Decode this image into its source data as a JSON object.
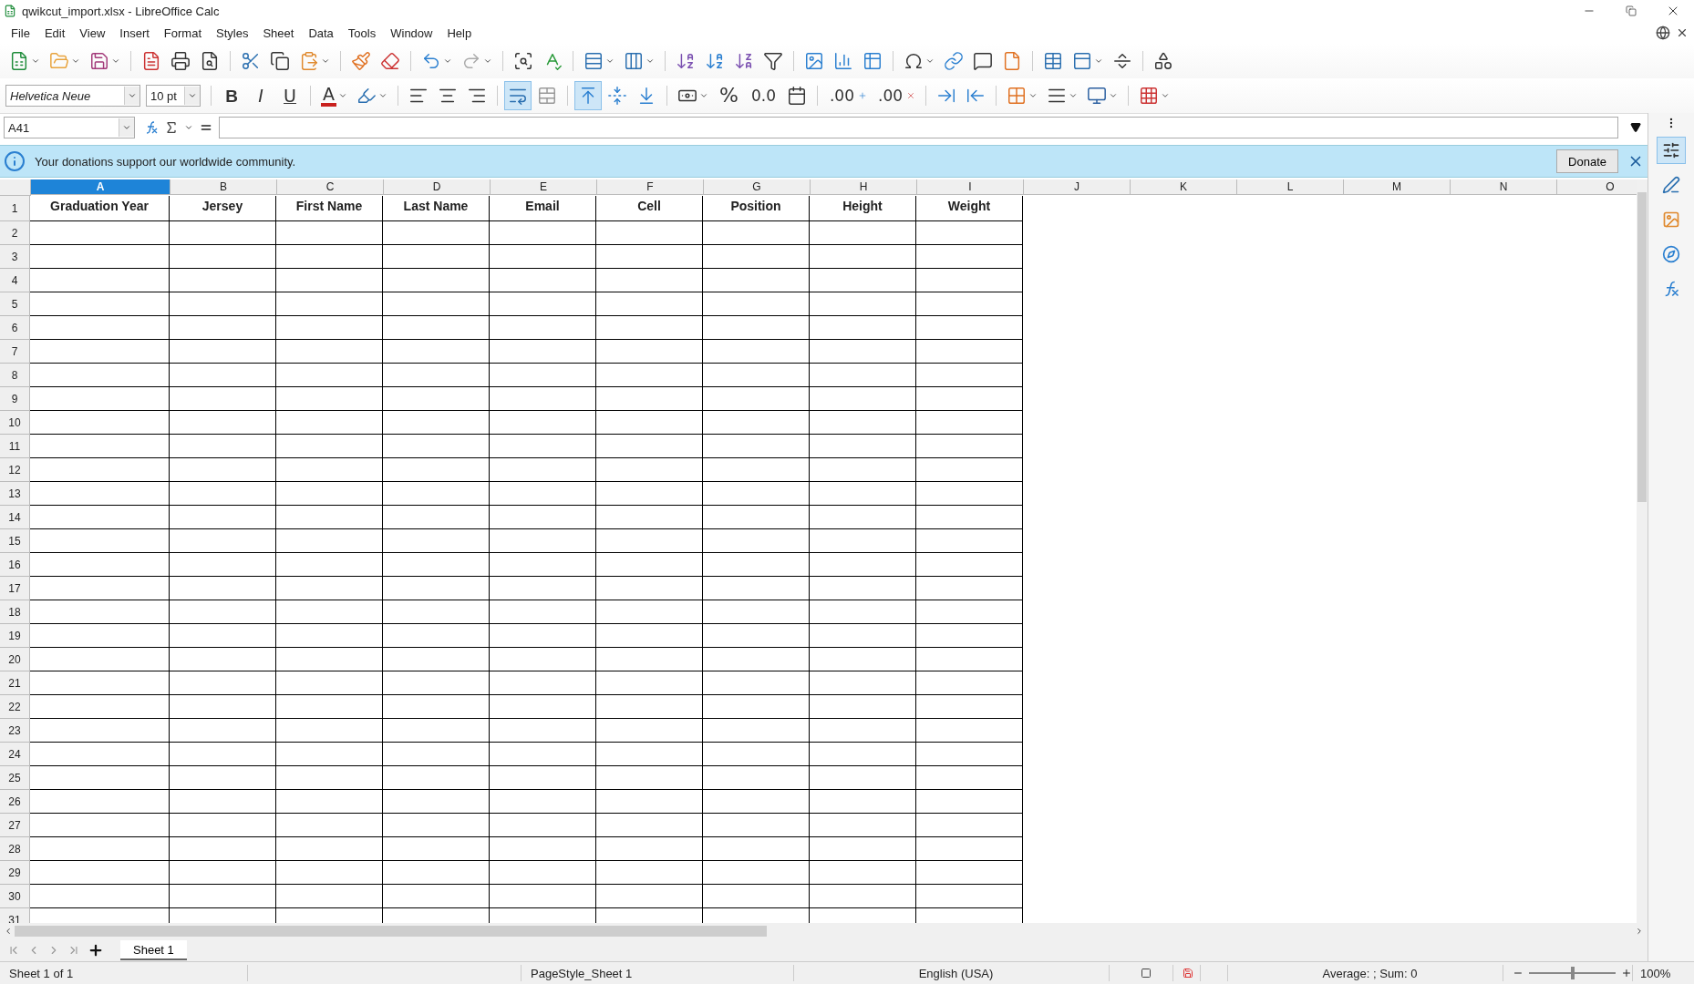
{
  "window": {
    "title": "qwikcut_import.xlsx - LibreOffice Calc"
  },
  "menu": [
    "File",
    "Edit",
    "View",
    "Insert",
    "Format",
    "Styles",
    "Sheet",
    "Data",
    "Tools",
    "Window",
    "Help"
  ],
  "toolbar_standard": [
    {
      "kind": "new",
      "dropdown": true
    },
    {
      "kind": "open",
      "dropdown": true
    },
    {
      "kind": "save",
      "dropdown": true
    },
    {
      "kind": "sep"
    },
    {
      "kind": "pdf",
      "dropdown": false
    },
    {
      "kind": "print",
      "dropdown": false
    },
    {
      "kind": "preview",
      "dropdown": false
    },
    {
      "kind": "sep"
    },
    {
      "kind": "cut",
      "dropdown": false
    },
    {
      "kind": "copy",
      "dropdown": false
    },
    {
      "kind": "paste",
      "dropdown": true
    },
    {
      "kind": "sep"
    },
    {
      "kind": "clone",
      "dropdown": false
    },
    {
      "kind": "clear",
      "dropdown": false
    },
    {
      "kind": "sep"
    },
    {
      "kind": "undo",
      "dropdown": true
    },
    {
      "kind": "redo",
      "dropdown": true
    },
    {
      "kind": "sep"
    },
    {
      "kind": "find",
      "dropdown": false
    },
    {
      "kind": "spell",
      "dropdown": false
    },
    {
      "kind": "sep"
    },
    {
      "kind": "row",
      "dropdown": true
    },
    {
      "kind": "column",
      "dropdown": true
    },
    {
      "kind": "sep"
    },
    {
      "kind": "sort",
      "dropdown": false
    },
    {
      "kind": "sort_asc",
      "dropdown": false
    },
    {
      "kind": "sort_desc",
      "dropdown": false
    },
    {
      "kind": "filter",
      "dropdown": false
    },
    {
      "kind": "sep"
    },
    {
      "kind": "image",
      "dropdown": false
    },
    {
      "kind": "chart",
      "dropdown": false
    },
    {
      "kind": "pivot",
      "dropdown": false
    },
    {
      "kind": "sep"
    },
    {
      "kind": "special",
      "dropdown": true
    },
    {
      "kind": "link",
      "dropdown": false
    },
    {
      "kind": "comment",
      "dropdown": false
    },
    {
      "kind": "header",
      "dropdown": false
    },
    {
      "kind": "sep"
    },
    {
      "kind": "print_range",
      "dropdown": false
    },
    {
      "kind": "freeze",
      "dropdown": true
    },
    {
      "kind": "split",
      "dropdown": false
    },
    {
      "kind": "sep"
    },
    {
      "kind": "shapes",
      "dropdown": false
    }
  ],
  "toolbar_format": {
    "font": "Helvetica Neue",
    "size": "10 pt",
    "buttons": [
      {
        "kind": "sep"
      },
      {
        "kind": "bold",
        "label": "B",
        "on": false,
        "dropdown": false
      },
      {
        "kind": "italic",
        "label": "I",
        "on": false,
        "dropdown": false
      },
      {
        "kind": "underline",
        "label": "U",
        "on": false,
        "dropdown": false
      },
      {
        "kind": "sep"
      },
      {
        "kind": "font_color",
        "label": "A",
        "on": false,
        "dropdown": true
      },
      {
        "kind": "highlight",
        "on": false,
        "dropdown": true
      },
      {
        "kind": "sep"
      },
      {
        "kind": "align_left",
        "on": false,
        "dropdown": false
      },
      {
        "kind": "align_center",
        "on": false,
        "dropdown": false
      },
      {
        "kind": "align_right",
        "on": false,
        "dropdown": false
      },
      {
        "kind": "sep"
      },
      {
        "kind": "wrap",
        "on": true,
        "dropdown": false
      },
      {
        "kind": "merge",
        "on": false,
        "dropdown": false
      },
      {
        "kind": "sep"
      },
      {
        "kind": "align_top",
        "on": true,
        "dropdown": false
      },
      {
        "kind": "align_middle",
        "on": false,
        "dropdown": false
      },
      {
        "kind": "align_bottom",
        "on": false,
        "dropdown": false
      },
      {
        "kind": "sep"
      },
      {
        "kind": "currency",
        "on": false,
        "dropdown": true
      },
      {
        "kind": "percent",
        "label": "%",
        "on": false,
        "dropdown": false
      },
      {
        "kind": "number",
        "label": "0.0",
        "on": false,
        "dropdown": false
      },
      {
        "kind": "date",
        "on": false,
        "dropdown": false
      },
      {
        "kind": "sep"
      },
      {
        "kind": "add_decimal",
        "label": ".00",
        "on": false,
        "dropdown": false
      },
      {
        "kind": "delete_decimal",
        "label": ".00",
        "on": false,
        "dropdown": false
      },
      {
        "kind": "sep"
      },
      {
        "kind": "indent",
        "on": false,
        "dropdown": false
      },
      {
        "kind": "outdent",
        "on": false,
        "dropdown": false
      },
      {
        "kind": "sep"
      },
      {
        "kind": "borders",
        "on": false,
        "dropdown": true
      },
      {
        "kind": "border_style",
        "on": false,
        "dropdown": true
      },
      {
        "kind": "border_color",
        "on": false,
        "dropdown": true
      },
      {
        "kind": "sep"
      },
      {
        "kind": "conditional",
        "on": false,
        "dropdown": true
      }
    ]
  },
  "formula_bar": {
    "cell": "A41"
  },
  "infobar": {
    "message": "Your donations support our worldwide community.",
    "button": "Donate"
  },
  "columns": [
    {
      "label": "A",
      "selected": true
    },
    {
      "label": "B",
      "selected": false
    },
    {
      "label": "C",
      "selected": false
    },
    {
      "label": "D",
      "selected": false
    },
    {
      "label": "E",
      "selected": false
    },
    {
      "label": "F",
      "selected": false
    },
    {
      "label": "G",
      "selected": false
    },
    {
      "label": "H",
      "selected": false
    },
    {
      "label": "I",
      "selected": false
    },
    {
      "label": "J",
      "selected": false
    },
    {
      "label": "K",
      "selected": false
    },
    {
      "label": "L",
      "selected": false
    },
    {
      "label": "M",
      "selected": false
    },
    {
      "label": "N",
      "selected": false
    },
    {
      "label": "O",
      "selected": false
    }
  ],
  "header_cells": [
    "Graduation Year",
    "Jersey",
    "First Name",
    "Last Name",
    "Email",
    "Cell",
    "Position",
    "Height",
    "Weight"
  ],
  "row_numbers": [
    "1",
    "2",
    "3",
    "4",
    "5",
    "6",
    "7",
    "8",
    "9",
    "10",
    "11",
    "12",
    "13",
    "14",
    "15",
    "16",
    "17",
    "18",
    "19",
    "20",
    "21",
    "22",
    "23",
    "24",
    "25",
    "26",
    "27",
    "28",
    "29",
    "30",
    "31"
  ],
  "sheet_tabs": [
    {
      "label": "Sheet 1",
      "selected": true
    }
  ],
  "status_bar": {
    "sheet": "Sheet 1 of 1",
    "page_style": "PageStyle_Sheet 1",
    "language": "English (USA)",
    "summary": "Average: ; Sum: 0",
    "zoom_slider": {
      "level": 0.5
    },
    "zoom": "100%"
  }
}
